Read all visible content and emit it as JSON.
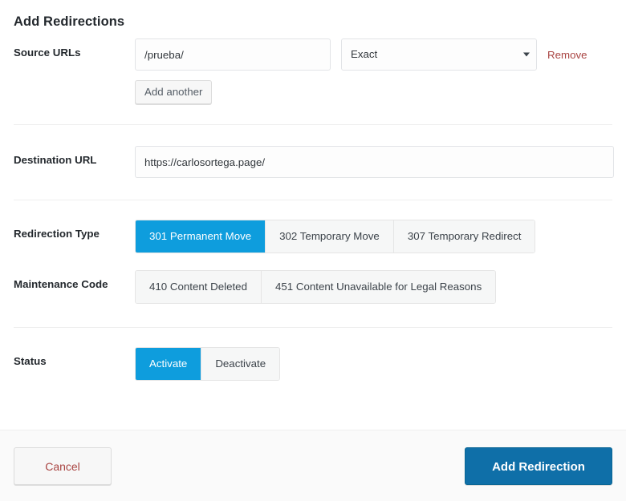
{
  "form": {
    "title": "Add Redirections",
    "rows": {
      "source": {
        "label": "Source URLs",
        "url_value": "/prueba/",
        "url_placeholder": "",
        "match_selected": "Exact",
        "match_options": [
          "Exact"
        ],
        "remove_label": "Remove",
        "add_another_label": "Add another"
      },
      "destination": {
        "label": "Destination URL",
        "value": "https://carlosortega.page/",
        "placeholder": ""
      },
      "redirection_type": {
        "label": "Redirection Type",
        "options": [
          {
            "label": "301 Permanent Move",
            "active": true
          },
          {
            "label": "302 Temporary Move",
            "active": false
          },
          {
            "label": "307 Temporary Redirect",
            "active": false
          }
        ]
      },
      "maintenance_code": {
        "label": "Maintenance Code",
        "options": [
          {
            "label": "410 Content Deleted",
            "active": false
          },
          {
            "label": "451 Content Unavailable for Legal Reasons",
            "active": false
          }
        ]
      },
      "status": {
        "label": "Status",
        "options": [
          {
            "label": "Activate",
            "active": true
          },
          {
            "label": "Deactivate",
            "active": false
          }
        ]
      }
    }
  },
  "footer": {
    "cancel_label": "Cancel",
    "submit_label": "Add Redirection"
  },
  "icons": {
    "select_caret": "chevron-down-icon"
  },
  "colors": {
    "accent_blue": "#0e9ddd",
    "primary_blue": "#0f6fa8",
    "danger_red": "#a94442",
    "border_gray": "#e2e4e7",
    "footer_bg": "#fafafa"
  }
}
